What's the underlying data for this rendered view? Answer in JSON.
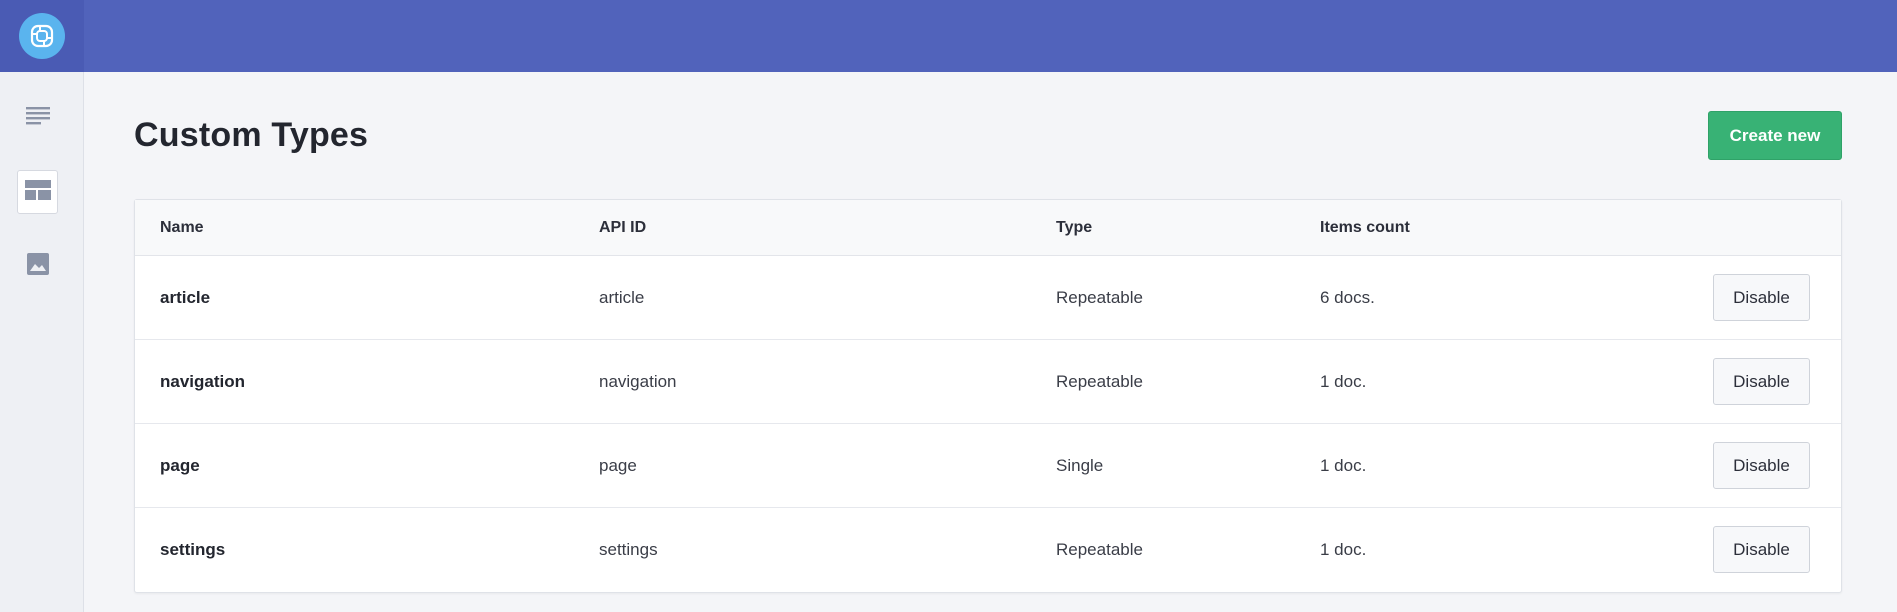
{
  "app": {
    "logo_icon": "prismic-logo-icon",
    "colors": {
      "topbar": "#5163bb",
      "logo_bg": "#5ab4ee",
      "create_button": "#38b275",
      "sidebar_icon": "#8a93a6"
    }
  },
  "sidebar": {
    "items": [
      {
        "icon": "list-lines-icon",
        "active": false
      },
      {
        "icon": "custom-types-layout-icon",
        "active": true
      },
      {
        "icon": "image-icon",
        "active": false
      }
    ]
  },
  "page": {
    "title": "Custom Types",
    "create_label": "Create new"
  },
  "table": {
    "headers": [
      "Name",
      "API ID",
      "Type",
      "Items count"
    ],
    "rows": [
      {
        "name": "article",
        "api_id": "article",
        "type": "Repeatable",
        "count": "6 docs.",
        "action": "Disable"
      },
      {
        "name": "navigation",
        "api_id": "navigation",
        "type": "Repeatable",
        "count": "1 doc.",
        "action": "Disable"
      },
      {
        "name": "page",
        "api_id": "page",
        "type": "Single",
        "count": "1 doc.",
        "action": "Disable"
      },
      {
        "name": "settings",
        "api_id": "settings",
        "type": "Repeatable",
        "count": "1 doc.",
        "action": "Disable"
      }
    ]
  }
}
